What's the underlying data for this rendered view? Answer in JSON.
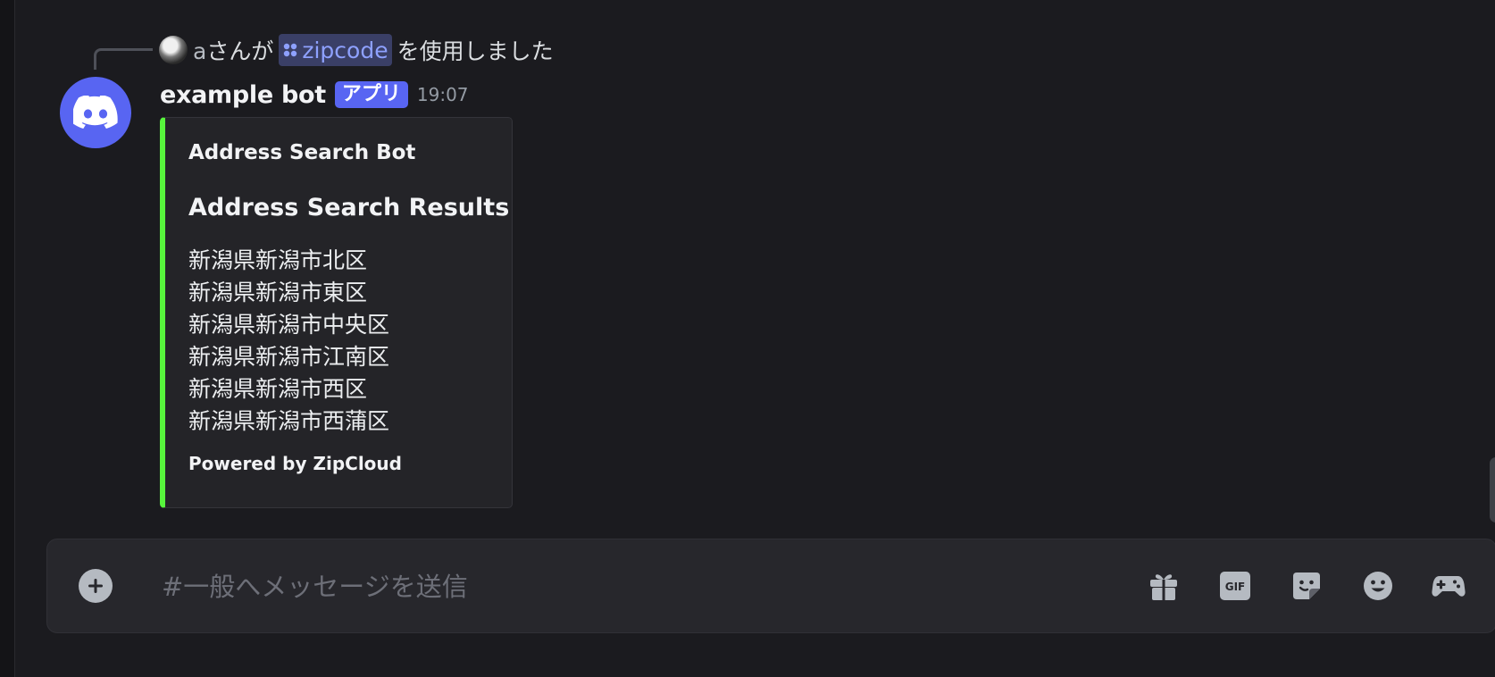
{
  "reply": {
    "username": "a",
    "text_before": "さんが",
    "command": "zipcode",
    "text_after": "を使用しました"
  },
  "message": {
    "username": "example bot",
    "badge": "アプリ",
    "timestamp": "19:07"
  },
  "embed": {
    "accent_color": "#57f53c",
    "author": "Address Search Bot",
    "title": "Address Search Results",
    "lines": [
      "新潟県新潟市北区",
      "新潟県新潟市東区",
      "新潟県新潟市中央区",
      "新潟県新潟市江南区",
      "新潟県新潟市西区",
      "新潟県新潟市西蒲区"
    ],
    "footer": "Powered by ZipCloud"
  },
  "composer": {
    "placeholder": "#一般へメッセージを送信",
    "tools": [
      "gift-icon",
      "gif-icon",
      "sticker-icon",
      "emoji-icon",
      "activity-icon"
    ]
  },
  "colors": {
    "brand": "#5865f2",
    "background": "#1b1b1f"
  }
}
